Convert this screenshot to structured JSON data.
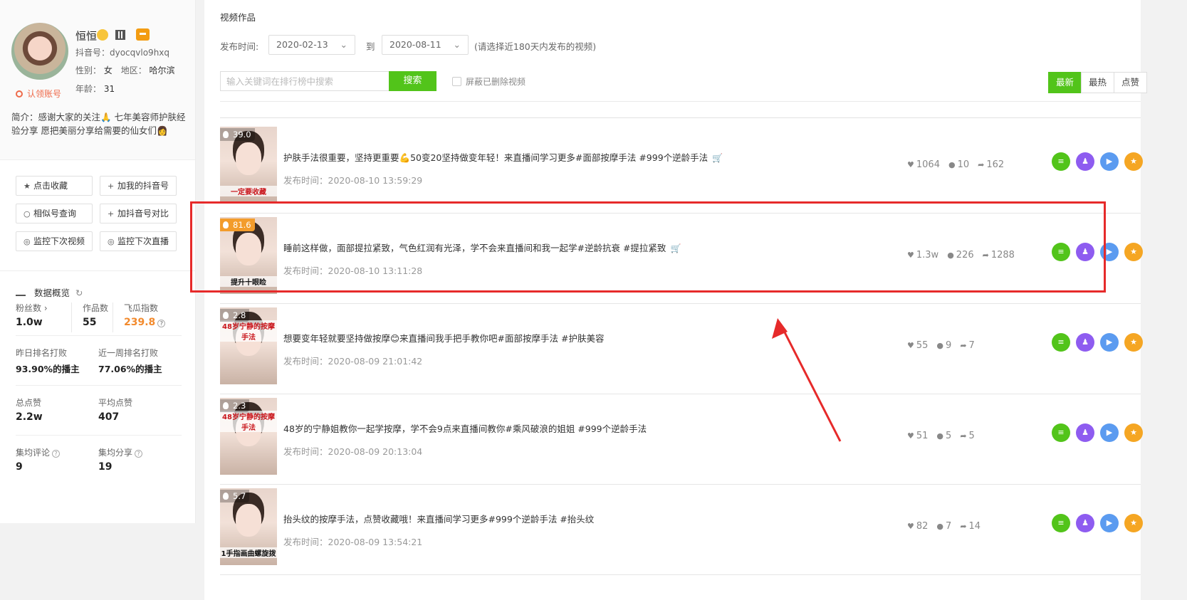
{
  "profile": {
    "nickname": "恒恒",
    "douyin_id": "抖音号：dyocqvlo9hxq",
    "gender_label": "性别：",
    "gender": "女",
    "region_label": "地区：",
    "region": "哈尔滨",
    "age_label": "年龄：",
    "age": "31",
    "claim": "认领账号",
    "bio": "简介：感谢大家的关注🙏 七年美容师护肤经验分享 愿把美丽分享给需要的仙女们👩"
  },
  "actions": [
    {
      "icon": "star-icon",
      "glyph": "★",
      "label": "点击收藏"
    },
    {
      "icon": "plus-icon",
      "glyph": "+",
      "label": "加我的抖音号"
    },
    {
      "icon": "search-icon",
      "glyph": "○",
      "label": "相似号查询"
    },
    {
      "icon": "plus-icon",
      "glyph": "+",
      "label": "加抖音号对比"
    },
    {
      "icon": "monitor-icon",
      "glyph": "◎",
      "label": "监控下次视频"
    },
    {
      "icon": "monitor-icon",
      "glyph": "◎",
      "label": "监控下次直播"
    }
  ],
  "overview": {
    "title": "数据概览",
    "fans_label": "粉丝数",
    "fans": "1.0w",
    "works_label": "作品数",
    "works": "55",
    "index_label": "飞瓜指数",
    "index": "239.8",
    "yesterday_label": "昨日排名打败",
    "yesterday": "93.90%的播主",
    "week_label": "近一周排名打败",
    "week": "77.06%的播主",
    "total_likes_label": "总点赞",
    "total_likes": "2.2w",
    "avg_likes_label": "平均点赞",
    "avg_likes": "407",
    "avg_comments_label": "集均评论",
    "avg_comments": "9",
    "avg_shares_label": "集均分享",
    "avg_shares": "19"
  },
  "main": {
    "section_title": "视频作品",
    "publish_label": "发布时间:",
    "date_from": "2020-02-13",
    "to_label": "到",
    "date_to": "2020-08-11",
    "date_hint": "(请选择近180天内发布的视频)",
    "search_placeholder": "输入关键词在排行榜中搜索",
    "search_button": "搜索",
    "hide_deleted": "屏蔽已删除视频",
    "sort": [
      "最新",
      "最热",
      "点赞"
    ]
  },
  "videos": [
    {
      "score": "39.0",
      "hot": false,
      "caption": "一定要收藏",
      "title": "护肤手法很重要，坚持更重要💪50变20坚持做变年轻！来直播间学习更多#面部按摩手法 #999个逆龄手法",
      "cart": true,
      "time": "发布时间：2020-08-10 13:59:29",
      "likes": "1064",
      "comments": "10",
      "shares": "162"
    },
    {
      "score": "81.6",
      "hot": true,
      "caption": "提升十眼睑",
      "title": "睡前这样做，面部提拉紧致，气色红润有光泽，学不会来直播间和我一起学#逆龄抗衰 #提拉紧致",
      "cart": true,
      "time": "发布时间：2020-08-10 13:11:28",
      "likes": "1.3w",
      "comments": "226",
      "shares": "1288"
    },
    {
      "score": "2.8",
      "hot": false,
      "caption": "48岁宁静的按摩手法",
      "title": "想要变年轻就要坚持做按摩😊来直播间我手把手教你吧#面部按摩手法 #护肤美容",
      "cart": false,
      "time": "发布时间：2020-08-09 21:01:42",
      "likes": "55",
      "comments": "9",
      "shares": "7"
    },
    {
      "score": "2.3",
      "hot": false,
      "caption": "48岁宁静的按摩手法",
      "title": "48岁的宁静姐教你一起学按摩，学不会9点来直播间教你#乘风破浪的姐姐 #999个逆龄手法",
      "cart": false,
      "time": "发布时间：2020-08-09 20:13:04",
      "likes": "51",
      "comments": "5",
      "shares": "5"
    },
    {
      "score": "5.7",
      "hot": false,
      "caption": "1手指画曲螺旋拨",
      "title": "抬头纹的按摩手法，点赞收藏哦！来直播间学习更多#999个逆龄手法 #抬头纹",
      "cart": false,
      "time": "发布时间：2020-08-09 13:54:21",
      "likes": "82",
      "comments": "7",
      "shares": "14"
    }
  ],
  "colors": {
    "accent_green": "#52c41a",
    "index_orange": "#f28a2d",
    "highlight_red": "#e62a2a",
    "op_purple": "#8e5cf0",
    "op_blue": "#5b9bf0",
    "op_orange": "#f5a623"
  }
}
